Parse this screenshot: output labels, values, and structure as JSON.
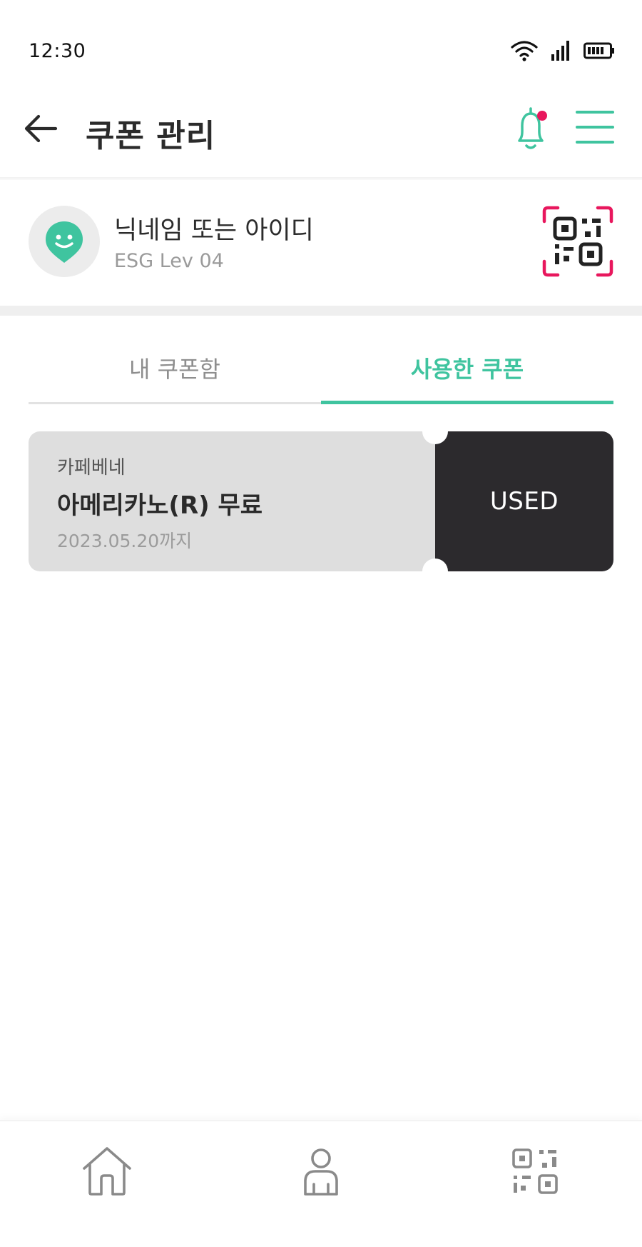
{
  "status_bar": {
    "time": "12:30",
    "icons": [
      "wifi-icon",
      "signal-icon",
      "battery-icon"
    ]
  },
  "header": {
    "title": "쿠폰 관리",
    "back_icon": "arrow-left-icon",
    "notification_icon": "bell-icon",
    "menu_icon": "hamburger-menu-icon"
  },
  "profile": {
    "nickname": "닉네임 또는 아이디",
    "level": "ESG Lev 04",
    "avatar_icon": "smiley-pin-icon",
    "qr_icon": "qr-scan-icon"
  },
  "tabs": [
    {
      "label": "내 쿠폰함",
      "active": false
    },
    {
      "label": "사용한 쿠폰",
      "active": true
    }
  ],
  "coupons": [
    {
      "brand": "카페베네",
      "name": "아메리카노(R) 무료",
      "expiry": "2023.05.20까지",
      "status": "USED"
    }
  ],
  "bottom_nav": {
    "items": [
      "home-icon",
      "person-icon",
      "qr-code-icon"
    ]
  },
  "colors": {
    "accent": "#3fc49f",
    "notification_dot": "#e8175d",
    "qr_frame": "#e8175d",
    "coupon_bg": "#dedede",
    "used_bg": "#2c2a2d"
  }
}
